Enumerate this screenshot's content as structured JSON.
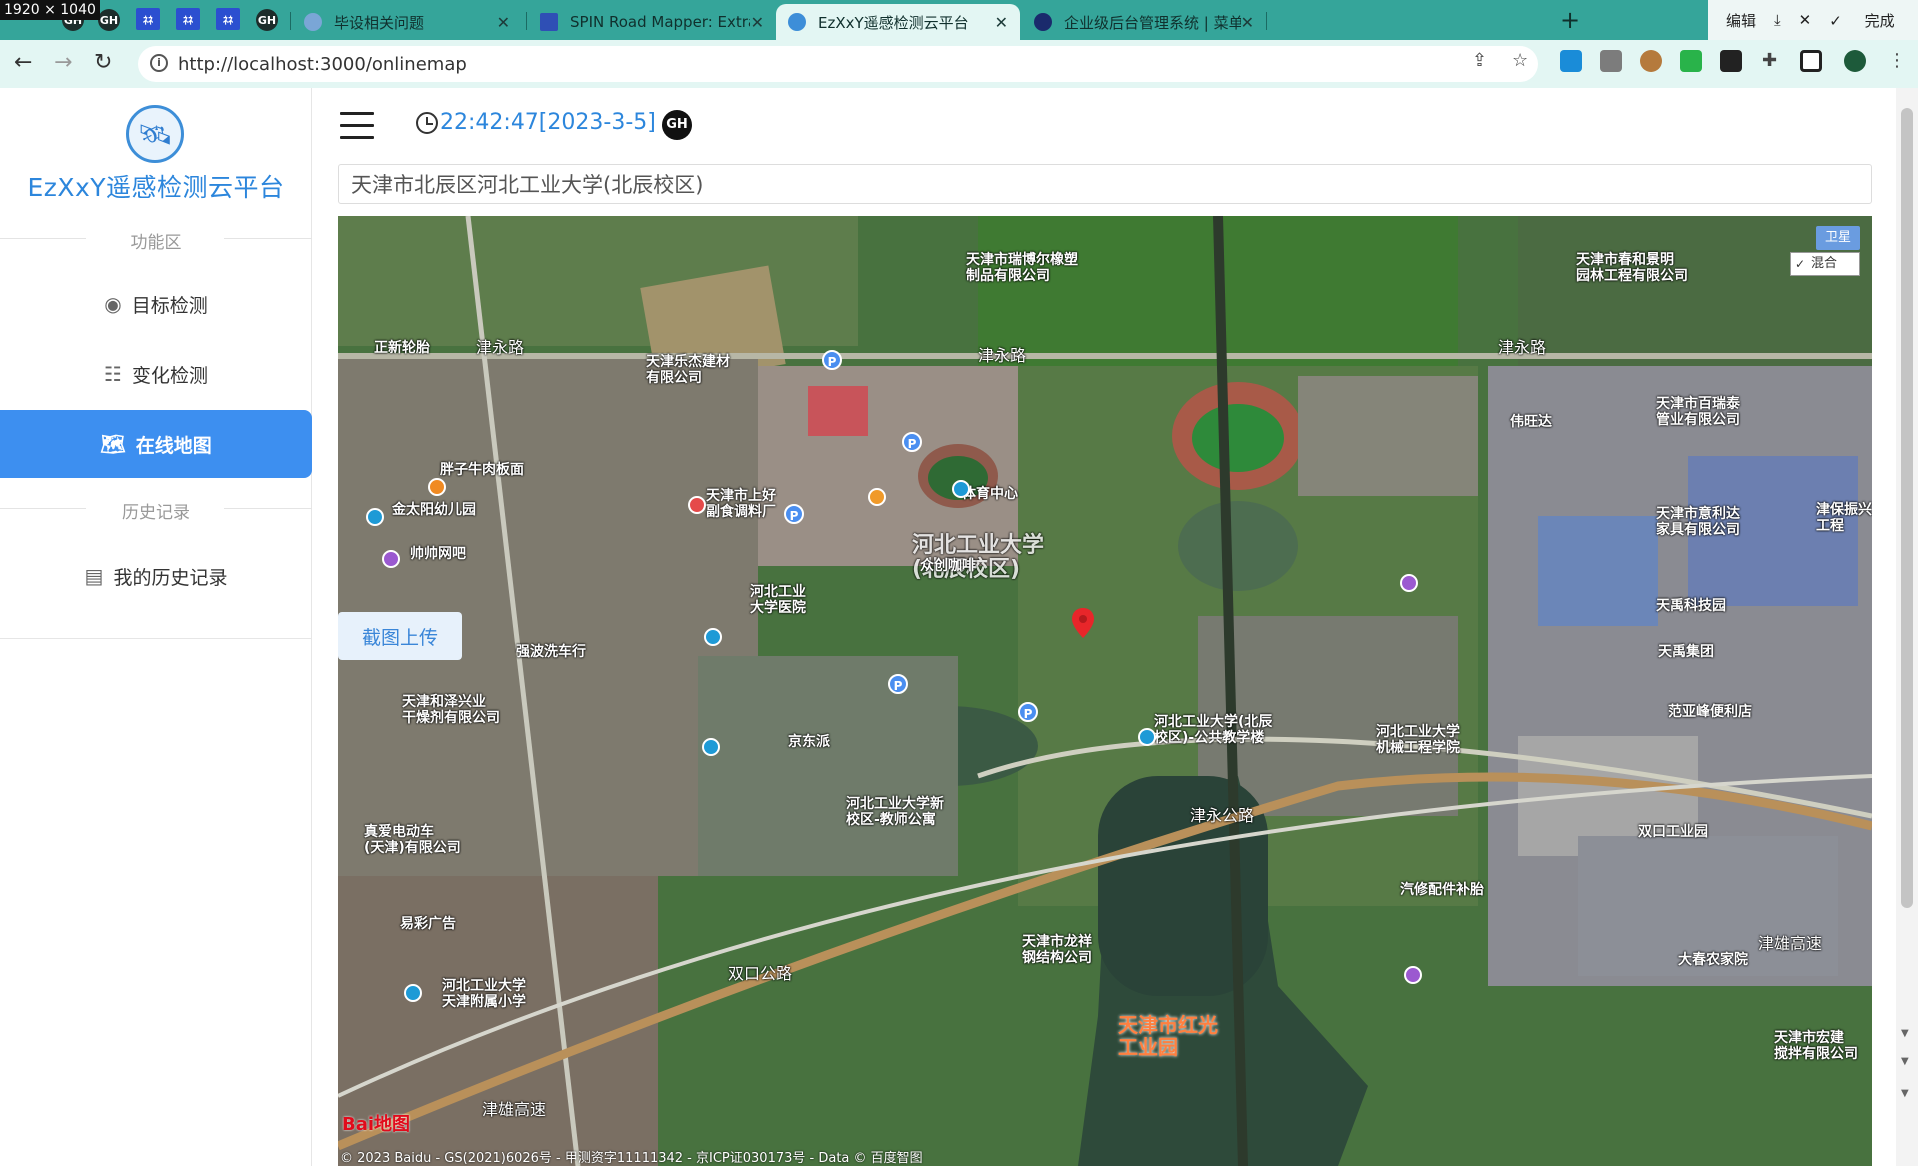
{
  "screen_size_label": "1920 × 1040",
  "browser": {
    "tabs": [
      {
        "title": "毕设相关问题",
        "favicon_color": "#7aa6d6"
      },
      {
        "title": "SPIN Road Mapper: Extracting",
        "favicon_color": "#2f4fb5"
      },
      {
        "title": "EzXxY遥感检测云平台",
        "favicon_color": "#3d8ed8",
        "active": true
      },
      {
        "title": "企业级后台管理系统 | 菜单管理",
        "favicon_color": "#1a2a6c"
      }
    ],
    "toolbar_right": {
      "edit": "编辑",
      "done": "完成"
    },
    "url": "http://localhost:3000/onlinemap"
  },
  "sidebar": {
    "brand": "EzXxY遥感检测云平台",
    "section_function": "功能区",
    "section_history": "历史记录",
    "items": [
      {
        "label": "目标检测",
        "icon": "target-icon"
      },
      {
        "label": "变化检测",
        "icon": "change-icon"
      },
      {
        "label": "在线地图",
        "icon": "map-icon",
        "active": true
      },
      {
        "label": "我的历史记录",
        "icon": "history-icon"
      }
    ]
  },
  "header": {
    "time": "22:42:47[2023-3-5]"
  },
  "search": {
    "value": "天津市北辰区河北工业大学(北辰校区)"
  },
  "map": {
    "screenshot_button": "截图上传",
    "type_satellite": "卫星",
    "type_hybrid": "混合",
    "logo": "Bai地图",
    "copyright": "© 2023 Baidu - GS(2021)6026号 - 甲测资字11111342 - 京ICP证030173号 - Data © 百度智图",
    "labels": {
      "campus": "河北工业大学\n(北辰校区)",
      "road_jinyong": "津永路",
      "road_jinyong2": "津永路",
      "road_jinyong_left": "津永路",
      "sports": "体育中心",
      "coffee": "众创咖啡",
      "hospital": "河北工业\n大学医院",
      "rubber": "天津市瑞博尔橡塑\n制品有限公司",
      "lejie": "天津乐杰建材\n有限公司",
      "zhengxin": "正新轮胎",
      "pangzi": "胖子牛肉板面",
      "jintaiyang": "金太阳幼儿园",
      "shuai": "帅帅网吧",
      "shanghao": "天津市上好\n副食调料厂",
      "qiangbo": "强波洗车行",
      "hezerui": "天津和泽兴业\n干燥剂有限公司",
      "zhenai": "真爱电动车\n(天津)有限公司",
      "yicai": "易彩广告",
      "fushu": "河北工业大学\n天津附属小学",
      "jingdong": "京东派",
      "teachers": "河北工业大学新\n校区-教师公寓",
      "jiaoxue": "河北工业大学(北辰\n校区)-公共教学楼",
      "jixie": "河北工业大学\n机械工程学院",
      "longxiang": "天津市龙祥\n钢结构公司",
      "hongguang": "天津市红光\n工业园",
      "qixiu": "汽修配件补胎",
      "jingxiong": "津雄高速",
      "jingxiong2": "津雄高速",
      "dachun": "大春农家院",
      "shuangkou": "双口工业园",
      "fanyafeng": "范亚峰便利店",
      "tianyu_group": "天禹集团",
      "tianyu_tech": "天禹科技园",
      "yilida": "天津市意利达\n家具有限公司",
      "baisheng": "天津市百瑞泰\n管业有限公司",
      "weiwangda": "伟旺达",
      "chunhe": "天津市春和景明\n园林工程有限公司",
      "hongjian": "天津市宏建\n搅拌有限公司",
      "jinbao": "津保振兴\n工程",
      "shuangkou_road": "双口公路",
      "jinchuang": "津永公路"
    }
  },
  "colors": {
    "brand": "#2c86dc",
    "active_menu": "#3d8ff0",
    "tabbar": "#35a59a"
  }
}
